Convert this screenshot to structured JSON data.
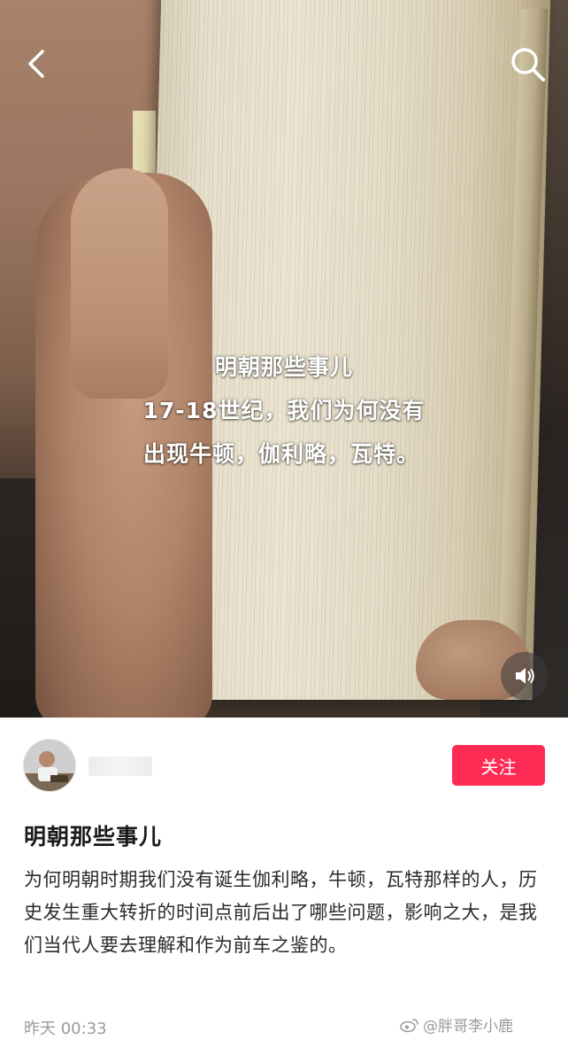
{
  "video": {
    "overlay_lines": [
      "明朝那些事儿",
      "17-18世纪，我们为何没有",
      "出现牛顿，伽利略，瓦特。"
    ],
    "icons": {
      "back": "chevron-left-icon",
      "search": "search-icon",
      "sound": "speaker-icon"
    }
  },
  "author": {
    "avatar": "avatar",
    "follow_label": "关注",
    "follow_color": "#fe2c55"
  },
  "post": {
    "title": "明朝那些事儿",
    "description": "为何明朝时期我们没有诞生伽利略，牛顿，瓦特那样的人，历史发生重大转折的时间点前后出了哪些问题，影响之大，是我们当代人要去理解和作为前车之鉴的。",
    "timestamp": "昨天 00:33"
  },
  "watermark": {
    "text": "@胖哥李小鹿",
    "icon": "weibo-icon"
  }
}
